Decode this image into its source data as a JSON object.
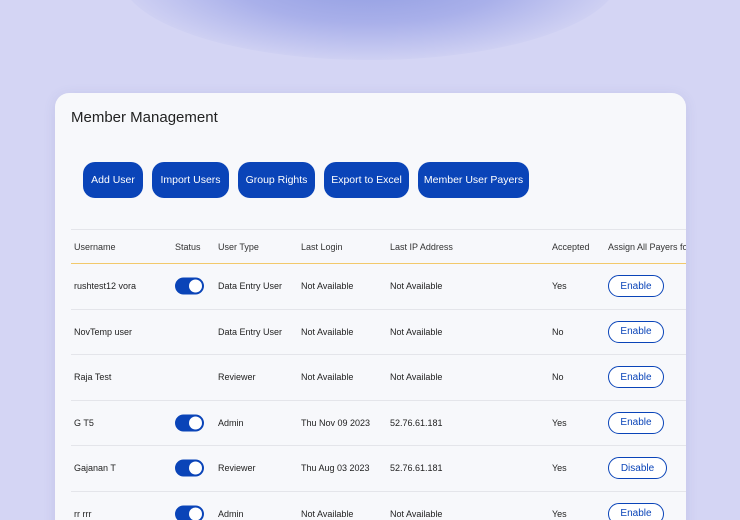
{
  "page": {
    "title": "Member Management"
  },
  "toolbar": {
    "buttons": [
      {
        "label": "Add User"
      },
      {
        "label": "Import Users"
      },
      {
        "label": "Group Rights"
      },
      {
        "label": "Export to Excel"
      },
      {
        "label": "Member User Payers"
      }
    ]
  },
  "table": {
    "headers": {
      "username": "Username",
      "status": "Status",
      "user_type": "User Type",
      "last_login": "Last Login",
      "last_ip": "Last IP Address",
      "accepted": "Accepted",
      "assign": "Assign All Payers for"
    },
    "rows": [
      {
        "username": "rushtest12 vora",
        "status_on": true,
        "user_type": "Data Entry User",
        "last_login": "Not Available",
        "last_ip": "Not Available",
        "accepted": "Yes",
        "action": "Enable"
      },
      {
        "username": "NovTemp user",
        "status_on": false,
        "user_type": "Data Entry User",
        "last_login": "Not Available",
        "last_ip": "Not Available",
        "accepted": "No",
        "action": "Enable"
      },
      {
        "username": "Raja Test",
        "status_on": false,
        "user_type": "Reviewer",
        "last_login": "Not Available",
        "last_ip": "Not Available",
        "accepted": "No",
        "action": "Enable"
      },
      {
        "username": "G T5",
        "status_on": true,
        "user_type": "Admin",
        "last_login": "Thu Nov 09 2023",
        "last_ip": "52.76.61.181",
        "accepted": "Yes",
        "action": "Enable"
      },
      {
        "username": "Gajanan T",
        "status_on": true,
        "user_type": "Reviewer",
        "last_login": "Thu Aug 03 2023",
        "last_ip": "52.76.61.181",
        "accepted": "Yes",
        "action": "Disable"
      },
      {
        "username": "rr rrr",
        "status_on": true,
        "user_type": "Admin",
        "last_login": "Not Available",
        "last_ip": "Not Available",
        "accepted": "Yes",
        "action": "Enable"
      }
    ]
  },
  "colors": {
    "accent": "#0a44b8",
    "background": "#d4d5f4",
    "header_divider": "#f2c96b"
  }
}
